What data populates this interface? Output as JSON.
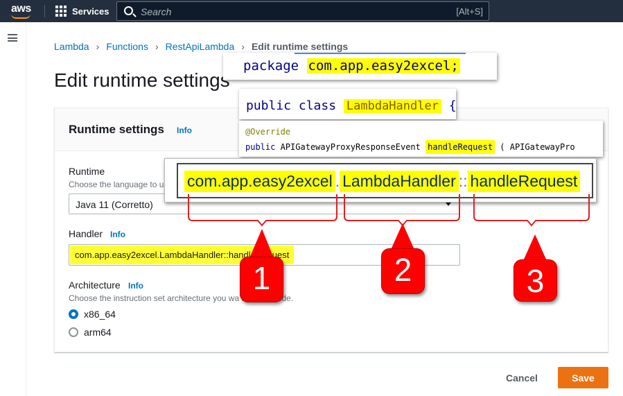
{
  "topnav": {
    "logo_text": "aws",
    "services_label": "Services",
    "search_placeholder": "Search",
    "search_shortcut": "[Alt+S]"
  },
  "breadcrumb": {
    "items": [
      "Lambda",
      "Functions",
      "RestApiLambda"
    ],
    "current": "Edit runtime settings"
  },
  "page_title": "Edit runtime settings",
  "panel": {
    "title": "Runtime settings",
    "info": "Info",
    "runtime": {
      "label": "Runtime",
      "description": "Choose the language to u",
      "value": "Java 11 (Corretto)"
    },
    "handler": {
      "label": "Handler",
      "info": "Info",
      "value": "com.app.easy2excel.LambdaHandler::handleRequest"
    },
    "architecture": {
      "label": "Architecture",
      "info": "Info",
      "description": "Choose the instruction set architecture you wa          function code.",
      "options": [
        "x86_64",
        "arm64"
      ],
      "selected": "x86_64"
    }
  },
  "footer": {
    "cancel_label": "Cancel",
    "save_label": "Save"
  },
  "overlays": {
    "package": {
      "keyword": "package",
      "name": "com.app.easy2excel;"
    },
    "class": {
      "keywords": "public class",
      "name": "LambdaHandler",
      "suffix": "{"
    },
    "method": {
      "annotation": "@Override",
      "keyword": "public",
      "return_type": "APIGatewayProxyResponseEvent",
      "name": "handleRequest",
      "params": "( APIGatewayPro"
    },
    "handler_breakdown": {
      "part1": "com.app.easy2excel",
      "sep1": ".",
      "part2": "LambdaHandler",
      "sep2": "::",
      "part3": "handleRequest"
    }
  },
  "callouts": [
    "1",
    "2",
    "3"
  ],
  "colors": {
    "nav_bg": "#232f3e",
    "link": "#0073bb",
    "save_button": "#ec7211",
    "highlight": "#ffff00",
    "callout": "#ff0000"
  }
}
